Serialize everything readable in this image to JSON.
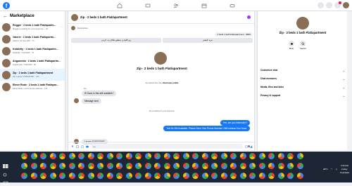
{
  "app": {
    "logo_letter": "f"
  },
  "left": {
    "title": "Marketplace",
    "conversations": [
      {
        "name": "Reggie · 2 beds 1 bath Flat/apartm...",
        "snippet": "Reggie is waiting for your response. · 4d"
      },
      {
        "name": "Valerie · 2 beds 1 bath Flat/apartm...",
        "snippet": "Valerie: 23 Sea Drift · 7h"
      },
      {
        "name": "Kiddiefly · 2 beds 1 bath Flat/apartm...",
        "snippet": "Kiddiefly: 7/12/2023 · 7h"
      },
      {
        "name": "Angumeda · 2 beds 1 bath Flat/apartm...",
        "snippet": "Angumeda: 7/12/2023 · 6h"
      },
      {
        "name": "Zip · 2 beds 1 bath Flat/apartment",
        "snippet": "Zip: Lauren 3135327087 · 14h"
      },
      {
        "name": "Elmer Rode · 2 beds 1 bath Flat/apar...",
        "snippet": "Elmer Rode: send me the address · 14h"
      }
    ]
  },
  "chat": {
    "header_title": "Zip · 2 beds 1 bath Flat/apartment",
    "market_label": "Marketplace",
    "listing_tag": "2 beds 1 bath Flat/apartment · $840",
    "quick_replies": [
      "زیر اللوا پے ہنظیو ملکان ہہ کرہی",
      "مزید کیشنز"
    ],
    "center_title": "Zip · 2 beds 1 bath Flat/apartment",
    "system_1": "Zip started this chat.",
    "system_1_link": "View buyer profile",
    "sender_label": "Zip",
    "msg_in_1": "Hi Sara, Is this still available?",
    "msg_in_2": "Message sent",
    "system_2": "Zip is waiting for your response.",
    "msg_out_1": "Yes, are you interested?",
    "msg_out_2": "Text Its Still Available. Please Send Your Phone Number I Will contract You Soon.",
    "msg_in_3": "Lauren 3135327087",
    "composer_placeholder": "Aa"
  },
  "right": {
    "title": "Zip · 2 beds 1 bath Flat/apartment",
    "actions": [
      {
        "label": "Mute"
      },
      {
        "label": "Search"
      }
    ],
    "items": [
      {
        "label": "Customize chat"
      },
      {
        "label": "Chat members"
      },
      {
        "label": "Media, files and links"
      },
      {
        "label": "Privacy & support"
      }
    ]
  },
  "taskbar": {
    "weather": "28°C",
    "time": "7:50 PM",
    "day": "Friday",
    "date": "7/14/2023"
  },
  "colors": {
    "fb_blue": "#1877f2",
    "bubble_in": "#e4e6eb",
    "active_row": "#e7f3ff",
    "taskbar": "#1c2635"
  }
}
